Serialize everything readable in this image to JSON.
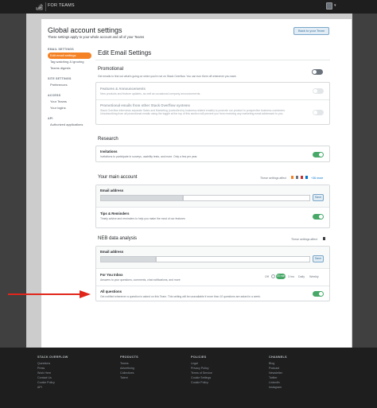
{
  "topbar": {
    "brand": "FOR TEAMS"
  },
  "header": {
    "title": "Global account settings",
    "subtitle": "These settings apply to your whole account and all of your Teams",
    "back_button": "Back to your Team"
  },
  "sidebar": {
    "sections": [
      {
        "heading": "EMAIL SETTINGS",
        "items": [
          "Edit email settings",
          "Tag watching & ignoring",
          "Teams digests"
        ]
      },
      {
        "heading": "SITE SETTINGS",
        "items": [
          "Preferences"
        ]
      },
      {
        "heading": "ACCESS",
        "items": [
          "Your Teams",
          "Your logins"
        ]
      },
      {
        "heading": "API",
        "items": [
          "Authorized applications"
        ]
      }
    ]
  },
  "main": {
    "title": "Edit Email Settings",
    "promotional": {
      "heading": "Promotional",
      "description": "Get emails to find out what's going on when you're not on Stack Overflow. You can turn them off whenever you want.",
      "features_title": "Features & Announcements",
      "features_desc": "New products and feature updates, as well as occasional company announcements.",
      "promo_title": "Promotional emails from other Stack Overflow systems",
      "promo_desc": "Stack Overflow interviews separate Sales and Marketing (controlled by business-related emails) to promote our product to prospective business customers. Unsubscribing from all promotional emails using the toggle at the top of this section will prevent you from receiving any marketing email addressed to you."
    },
    "research": {
      "heading": "Research",
      "invitations_title": "Invitations",
      "invitations_desc": "Invitations to participate in surveys, usability tests, and more. Only a few per year."
    },
    "main_account": {
      "heading": "Your main account",
      "applies_note": "These settings affect",
      "more_link": "+36 more",
      "email_label": "Email address",
      "save_label": "Save",
      "tips_title": "Tips & Reminders",
      "tips_desc": "Timely advice and reminders to help you make the most of our features"
    },
    "neb": {
      "heading": "NEB data analysis",
      "applies_note": "These settings affect",
      "email_label": "Email address",
      "save_label": "Save",
      "inbox_title": "For You Inbox",
      "inbox_desc": "Answers to your questions, comments, chat notifications, and more",
      "frequency_options": [
        "Off",
        "15 min",
        "3 hrs",
        "Daily",
        "Weekly"
      ],
      "frequency_selected": "15 min",
      "allq_title": "All questions",
      "allq_desc": "Get notified whenever a question is asked on this Team. This setting will be unavailable if more than 10 questions are asked in a week."
    }
  },
  "footer": {
    "columns": [
      {
        "heading": "STACK OVERFLOW",
        "links": [
          "Questions",
          "Press",
          "Work Here",
          "Contact Us",
          "Cookie Policy",
          "API"
        ]
      },
      {
        "heading": "PRODUCTS",
        "links": [
          "Teams",
          "Advertising",
          "Collectives",
          "Talent"
        ]
      },
      {
        "heading": "POLICIES",
        "links": [
          "Legal",
          "Privacy Policy",
          "Terms of Service",
          "Cookie Settings",
          "Cookie Policy"
        ]
      },
      {
        "heading": "CHANNELS",
        "links": [
          "Blog",
          "Podcast",
          "Newsletter",
          "Twitter",
          "LinkedIn",
          "Instagram"
        ]
      }
    ]
  },
  "colors": {
    "accent": "#f48225",
    "toggle_on": "#48a868",
    "annotation_arrow": "#e0261b",
    "link": "#0074cc"
  }
}
